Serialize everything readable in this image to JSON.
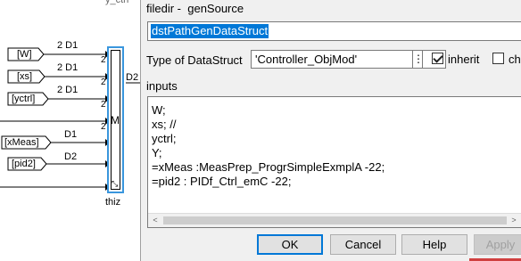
{
  "canvas": {
    "top_label": "y_ctrl",
    "inports": [
      {
        "name": "[W]",
        "dim": "2 D1"
      },
      {
        "name": "[xs]",
        "dim": "2 D1"
      },
      {
        "name": "[yctrl]",
        "dim": "2 D1"
      },
      {
        "name": "[xMeas]",
        "dim": "D1"
      },
      {
        "name": "[pid2]",
        "dim": "D2"
      }
    ],
    "output_dim": "D2",
    "mux_label": "M",
    "mux_name": "thiz",
    "port_numbers": [
      "2",
      "2",
      "2",
      "2"
    ]
  },
  "dialog": {
    "header": "filedir -  genSource",
    "name_value": "dstPathGenDataStruct",
    "type_label": "Type of DataStruct",
    "type_value": "'Controller_ObjMod'",
    "menu_glyph": "⋮",
    "inherit_label": "inherit",
    "inherit_checked": true,
    "second_check_label": "cha",
    "second_checked": false,
    "inputs_label": "inputs",
    "inputs_text": "W;\nxs; //\nyctrl;\nY;\n=xMeas :MeasPrep_ProgrSimpleExmplA -22;\n=pid2 : PIDf_Ctrl_emC -22;",
    "scroll_left": "<",
    "scroll_right": ">",
    "buttons": {
      "ok": "OK",
      "cancel": "Cancel",
      "help": "Help",
      "apply": "Apply"
    }
  }
}
